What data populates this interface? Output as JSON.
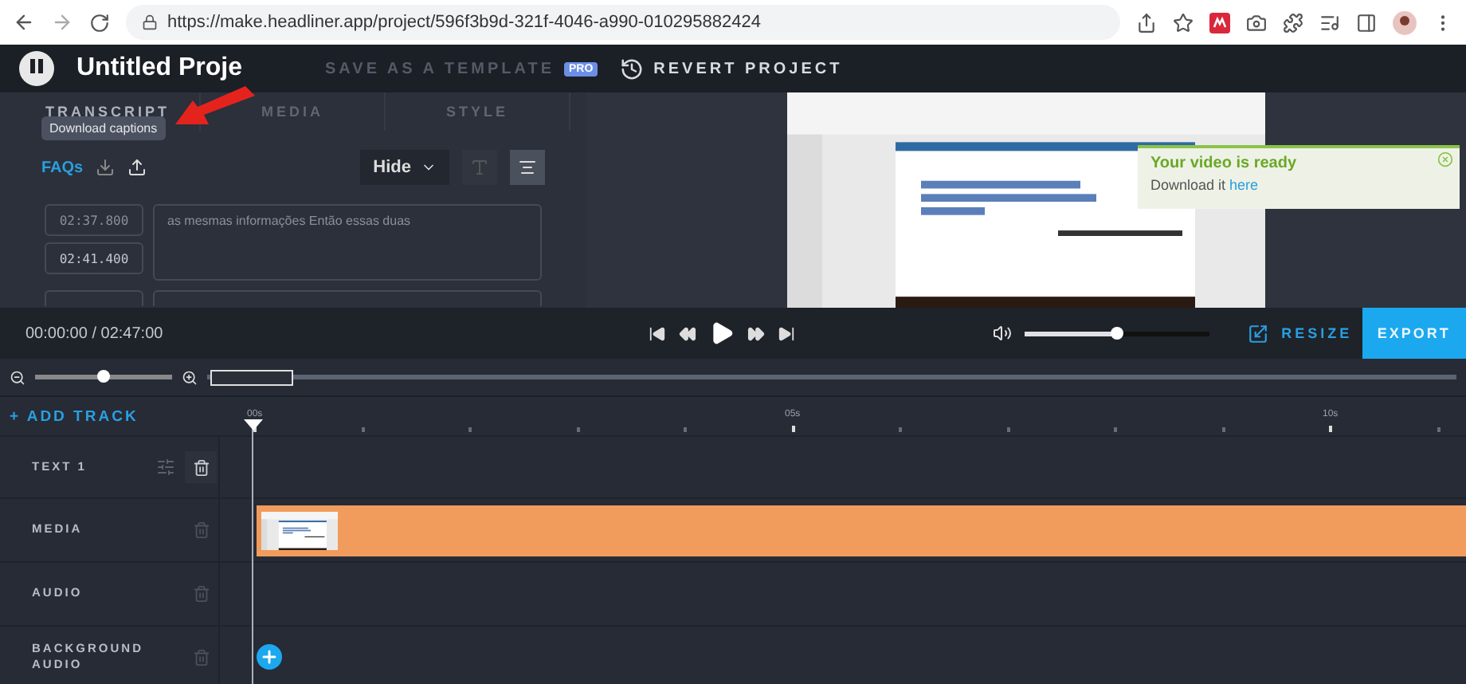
{
  "browser": {
    "url": "https://make.headliner.app/project/596f3b9d-321f-4046-a990-010295882424"
  },
  "header": {
    "title": "Untitled Proje",
    "save_template": "SAVE AS A TEMPLATE",
    "pro_badge": "PRO",
    "revert": "REVERT PROJECT"
  },
  "notification": {
    "title": "Your video is ready",
    "text": "Download it",
    "link": "here"
  },
  "panel": {
    "tabs": [
      {
        "label": "TRANSCRIPT",
        "selected": true
      },
      {
        "label": "MEDIA",
        "selected": false
      },
      {
        "label": "STYLE",
        "selected": false
      }
    ],
    "tooltip": "Download captions",
    "faqs": "FAQs",
    "visibility": "Hide",
    "captions": [
      {
        "start": "02:37.800",
        "end": "02:41.400",
        "text": "as mesmas informações Então essas duas"
      }
    ]
  },
  "transport": {
    "time": "00:00:00 / 02:47:00",
    "volume": {
      "level": 0.5
    },
    "resize": "RESIZE",
    "export": "EXPORT"
  },
  "zoom": {
    "level": 0.5
  },
  "timeline": {
    "add_track": "+ ADD TRACK",
    "ruler": [
      "00s",
      "05s",
      "10s"
    ],
    "tracks": [
      {
        "label": "TEXT 1",
        "kind": "text"
      },
      {
        "label": "MEDIA",
        "kind": "media"
      },
      {
        "label": "AUDIO",
        "kind": "audio"
      },
      {
        "label": "BACKGROUND AUDIO",
        "kind": "background"
      }
    ]
  }
}
